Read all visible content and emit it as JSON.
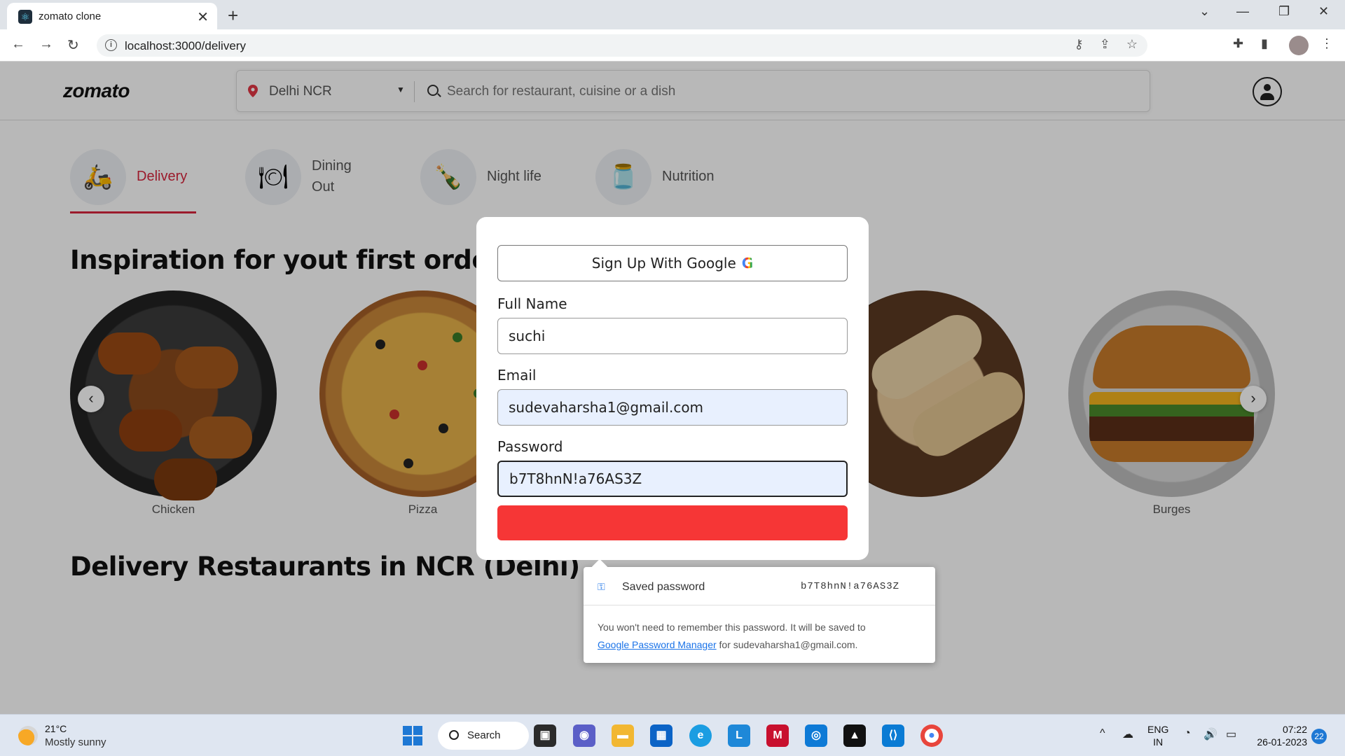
{
  "browser": {
    "tab_title": "zomato clone",
    "url": "localhost:3000/delivery"
  },
  "header": {
    "logo": "zomato",
    "location": "Delhi NCR",
    "search_placeholder": "Search for restaurant, cuisine or a dish"
  },
  "categories": [
    {
      "label": "Delivery",
      "icon": "scooter-icon",
      "active": true
    },
    {
      "label_line1": "Dining",
      "label_line2": "Out",
      "icon": "plate-icon"
    },
    {
      "label": "Night life",
      "icon": "bottle-icon"
    },
    {
      "label": "Nutrition",
      "icon": "supplement-jar-icon"
    }
  ],
  "inspiration": {
    "title": "Inspiration for yout first order",
    "items": [
      "Chicken",
      "Pizza",
      "Burges"
    ]
  },
  "delivery_title": "Delivery Restaurants in NCR (Delhi)",
  "modal": {
    "google_button": "Sign Up With Google",
    "google_letter": "G",
    "full_name_label": "Full Name",
    "full_name_value": "suchi",
    "email_label": "Email",
    "email_value": "sudevaharsha1@gmail.com",
    "password_label": "Password",
    "password_value": "b7T8hnN!a76AS3Z"
  },
  "password_popup": {
    "title": "Saved password",
    "value": "b7T8hnN!a76AS3Z",
    "note_start": "You won't need to remember this password. It will be saved to",
    "link": "Google Password Manager",
    "note_end": "for sudevaharsha1@gmail.com."
  },
  "taskbar": {
    "temp": "21°C",
    "weather": "Mostly sunny",
    "search": "Search",
    "lang1": "ENG",
    "lang2": "IN",
    "time": "07:22",
    "date": "26-01-2023",
    "notifications": "22"
  },
  "colors": {
    "accent": "#d7263d",
    "submit": "#f63636",
    "autofill": "#e8f0fe"
  }
}
